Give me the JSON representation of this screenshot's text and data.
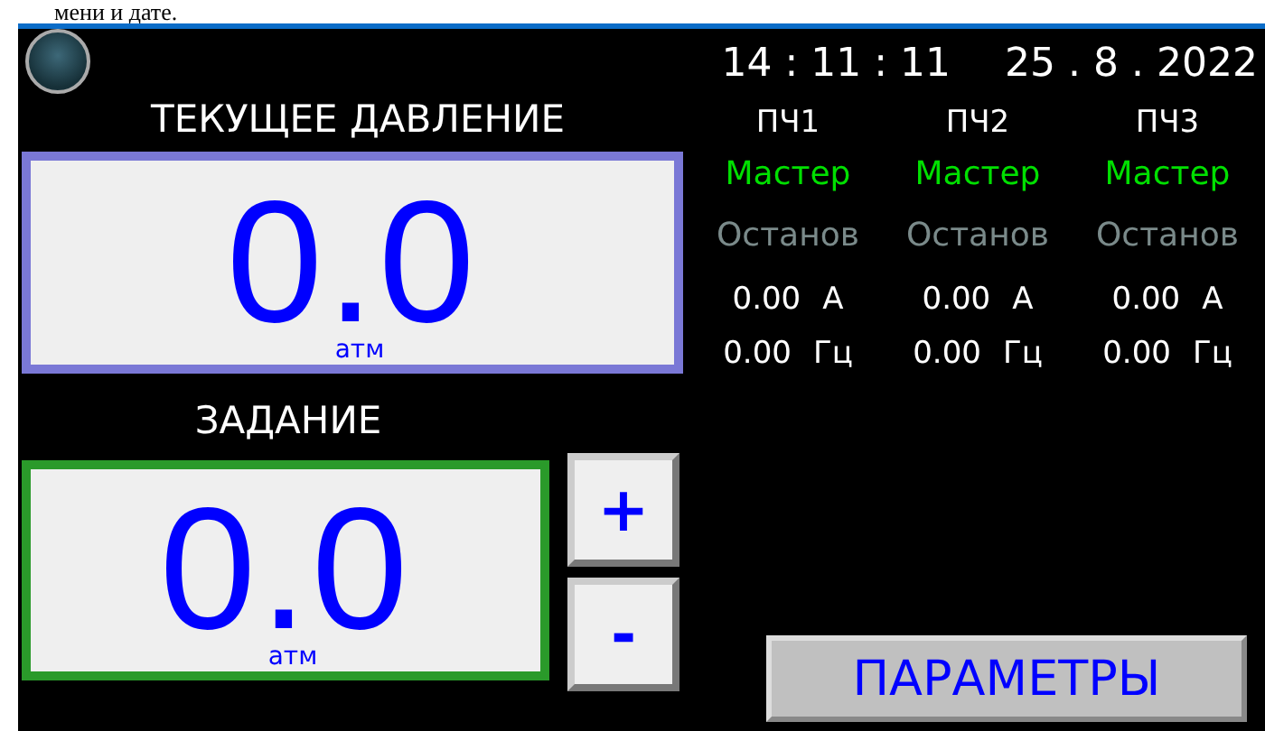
{
  "document_text": "мени и дате.",
  "panel": {
    "lamp": {
      "on": false
    },
    "time": "14 : 11 : 11",
    "date": "25 . 8 . 2022",
    "current_pressure": {
      "label": "ТЕКУЩЕЕ ДАВЛЕНИЕ",
      "value": "0.0",
      "unit": "атм"
    },
    "setpoint": {
      "label": "ЗАДАНИЕ",
      "value": "0.0",
      "unit": "атм"
    },
    "step_buttons": [
      "+",
      "-"
    ],
    "drives": [
      {
        "name": "ПЧ1",
        "mode": "Мастер",
        "state": "Останов",
        "current": "0.00",
        "current_unit": "А",
        "frequency": "0.00",
        "frequency_unit": "Гц"
      },
      {
        "name": "ПЧ2",
        "mode": "Мастер",
        "state": "Останов",
        "current": "0.00",
        "current_unit": "А",
        "frequency": "0.00",
        "frequency_unit": "Гц"
      },
      {
        "name": "ПЧ3",
        "mode": "Мастер",
        "state": "Останов",
        "current": "0.00",
        "current_unit": "А",
        "frequency": "0.00",
        "frequency_unit": "Гц"
      }
    ],
    "parameters_button": "ПАРАМЕТРЫ"
  }
}
